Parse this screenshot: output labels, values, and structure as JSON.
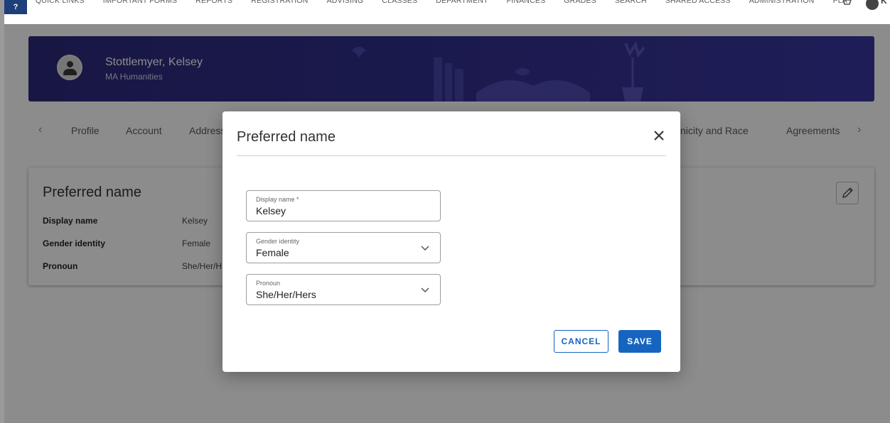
{
  "topnav": {
    "items": [
      "QUICK LINKS",
      "IMPORTANT FORMS",
      "REPORTS",
      "REGISTRATION",
      "ADVISING",
      "CLASSES",
      "DEPARTMENT",
      "FINANCES",
      "GRADES",
      "SEARCH",
      "SHARED ACCESS",
      "ADMINISTRATION",
      "PLA"
    ],
    "user_initial": "K"
  },
  "banner": {
    "name": "Stottlemyer, Kelsey",
    "program": "MA Humanities"
  },
  "tabs": {
    "items": [
      "Profile",
      "Account",
      "Address",
      "Ethnicity and Race",
      "Agreements"
    ]
  },
  "card": {
    "title": "Preferred name",
    "fields": [
      {
        "label": "Display name",
        "value": "Kelsey"
      },
      {
        "label": "Gender identity",
        "value": "Female"
      },
      {
        "label": "Pronoun",
        "value": "She/Her/H"
      }
    ]
  },
  "modal": {
    "title": "Preferred name",
    "display_name": {
      "label": "Display name *",
      "value": "Kelsey"
    },
    "gender_identity": {
      "label": "Gender identity",
      "value": "Female"
    },
    "pronoun": {
      "label": "Pronoun",
      "value": "She/Her/Hers"
    },
    "cancel_label": "CANCEL",
    "save_label": "SAVE"
  },
  "colors": {
    "banner": "#2c2a7c",
    "primary": "#1565c0"
  }
}
